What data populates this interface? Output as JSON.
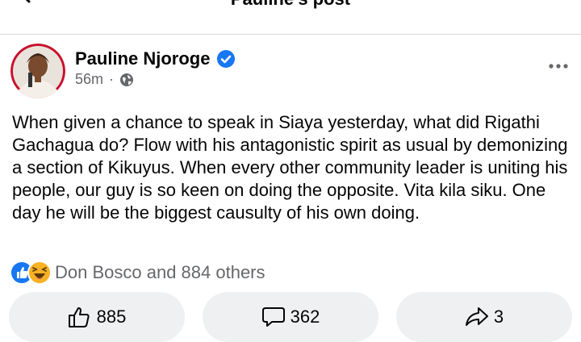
{
  "header": {
    "title": "Pauline's post"
  },
  "post": {
    "author": "Pauline Njoroge",
    "time": "56m",
    "separator": "·",
    "text": "When given a chance to speak in Siaya yesterday, what did Rigathi Gachagua do? Flow with his antagonistic spirit as usual by demonizing a section of Kikuyus. When every other community leader is uniting his people, our guy is so keen on doing the opposite. Vita kila siku. One day he will be the biggest causulty of his own doing."
  },
  "reactions": {
    "summary": "Don Bosco and 884 others"
  },
  "actions": {
    "likes": "885",
    "comments": "362",
    "shares": "3"
  },
  "colors": {
    "verified": "#1877f2",
    "like_blue": "#1877f2",
    "haha_yellow": "#f7b125",
    "button_bg": "#eef0f2"
  }
}
